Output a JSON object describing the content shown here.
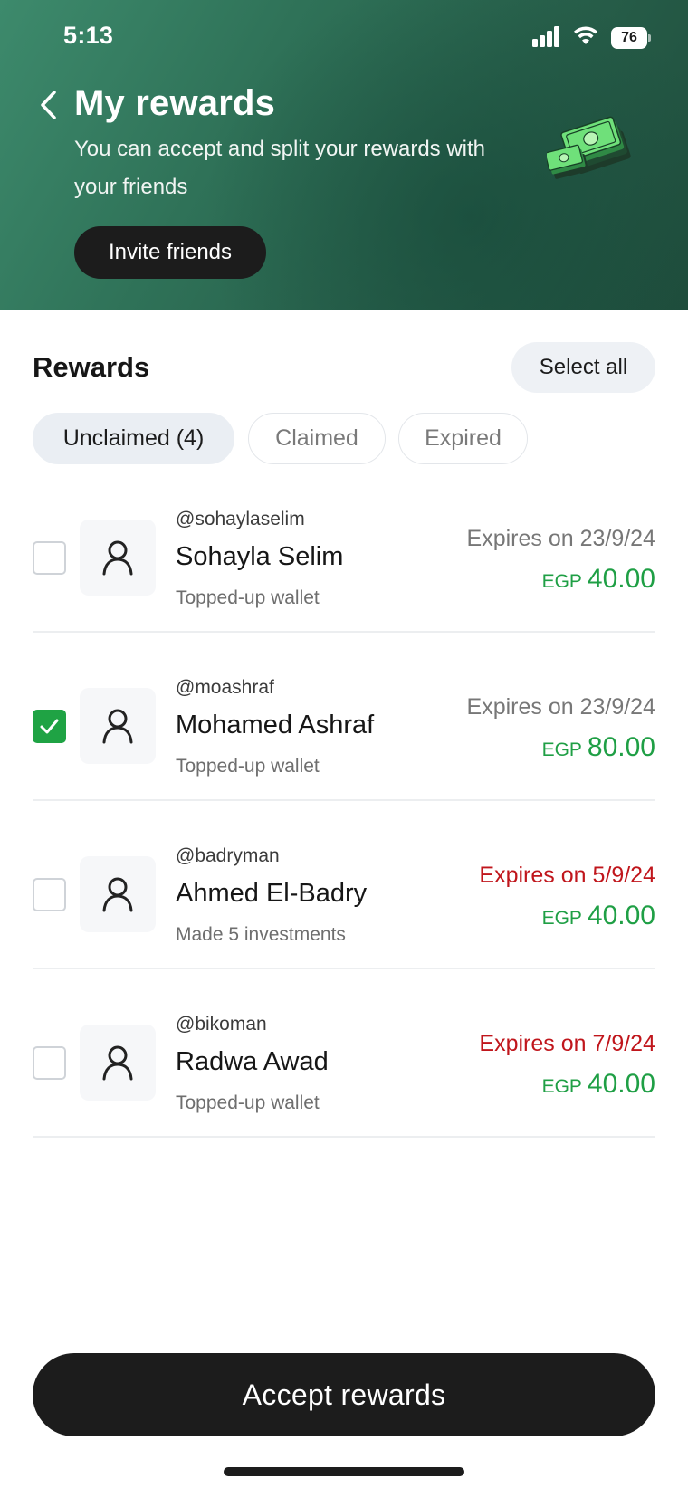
{
  "status_bar": {
    "time": "5:13",
    "battery": "76"
  },
  "header": {
    "title": "My rewards",
    "subtitle": "You can accept and split your rewards with your friends",
    "invite_label": "Invite friends",
    "colors": {
      "gradient_start": "#3d8a6c",
      "gradient_end": "#1f4d3c"
    }
  },
  "rewards_section": {
    "title": "Rewards",
    "select_all_label": "Select all",
    "tabs": [
      {
        "label": "Unclaimed (4)",
        "active": true
      },
      {
        "label": "Claimed",
        "active": false
      },
      {
        "label": "Expired",
        "active": false
      }
    ],
    "items": [
      {
        "handle": "@sohaylaselim",
        "name": "Sohayla Selim",
        "reason": "Topped-up wallet",
        "expiry": "Expires on 23/9/24",
        "urgent": false,
        "currency": "EGP",
        "amount": "40.00",
        "checked": false
      },
      {
        "handle": "@moashraf",
        "name": "Mohamed Ashraf",
        "reason": "Topped-up wallet",
        "expiry": "Expires on 23/9/24",
        "urgent": false,
        "currency": "EGP",
        "amount": "80.00",
        "checked": true
      },
      {
        "handle": "@badryman",
        "name": "Ahmed El-Badry",
        "reason": "Made 5 investments",
        "expiry": "Expires on 5/9/24",
        "urgent": true,
        "currency": "EGP",
        "amount": "40.00",
        "checked": false
      },
      {
        "handle": "@bikoman",
        "name": "Radwa Awad",
        "reason": "Topped-up wallet",
        "expiry": "Expires on 7/9/24",
        "urgent": true,
        "currency": "EGP",
        "amount": "40.00",
        "checked": false
      }
    ]
  },
  "footer": {
    "accept_label": "Accept rewards"
  },
  "colors": {
    "accent_green": "#1fa344",
    "amount_green": "#1f9f45",
    "urgent_red": "#c0161c",
    "primary_button": "#1c1c1c"
  },
  "icons": {
    "back": "chevron-left-icon",
    "avatar": "user-icon",
    "check": "check-icon",
    "illustration": "money-stack-icon"
  }
}
